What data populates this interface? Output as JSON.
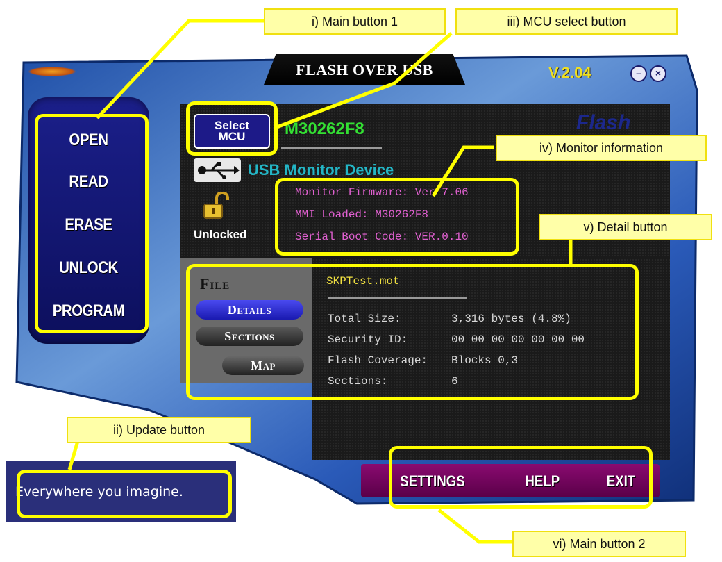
{
  "window": {
    "title": "Flash Over USB",
    "version": "V.2.04",
    "minimize_glyph": "–",
    "close_glyph": "×"
  },
  "main_buttons": [
    "OPEN",
    "READ",
    "ERASE",
    "UNLOCK",
    "PROGRAM"
  ],
  "mcu": {
    "select_label_line1": "Select",
    "select_label_line2": "MCU",
    "name": "M30262F8",
    "background_word": "Flash"
  },
  "device": {
    "usb_label": "USB Monitor Device",
    "lock_status": "Unlocked"
  },
  "monitor_info": [
    "Monitor Firmware: Ver 7.06",
    "MMI Loaded: M30262F8",
    "Serial Boot Code: VER.0.10"
  ],
  "file": {
    "title": "File",
    "tabs": [
      "Details",
      "Sections",
      "Map"
    ],
    "name": "SKPTest.mot",
    "details": [
      {
        "key": "Total Size:",
        "value": "3,316 bytes  (4.8%)"
      },
      {
        "key": "Security ID:",
        "value": "00 00 00 00 00 00 00"
      },
      {
        "key": "Flash Coverage:",
        "value": "Blocks 0,3"
      },
      {
        "key": "Sections:",
        "value": "6"
      }
    ]
  },
  "bottom_buttons": [
    "SETTINGS",
    "HELP",
    "EXIT"
  ],
  "update_banner": "Everywhere you imagine.",
  "callouts": {
    "main1": "i) Main button 1",
    "update": "ii) Update button",
    "mcu_select": "iii) MCU select button",
    "monitor": "iv) Monitor information",
    "detail": "v) Detail button",
    "main2": "vi) Main button 2"
  },
  "icons": [
    "usb-icon",
    "padlock-open-icon",
    "minimize-icon",
    "close-icon",
    "logo-icon"
  ],
  "colors": {
    "frame_blue": "#2a5ab8",
    "panel_dark": "#1a1a1a",
    "accent_green": "#33e033",
    "accent_cyan": "#23b5c5",
    "accent_pink": "#e060d0",
    "accent_yellow": "#f0e040",
    "bottom_bar": "#7a0862",
    "highlight": "#ffff00"
  }
}
